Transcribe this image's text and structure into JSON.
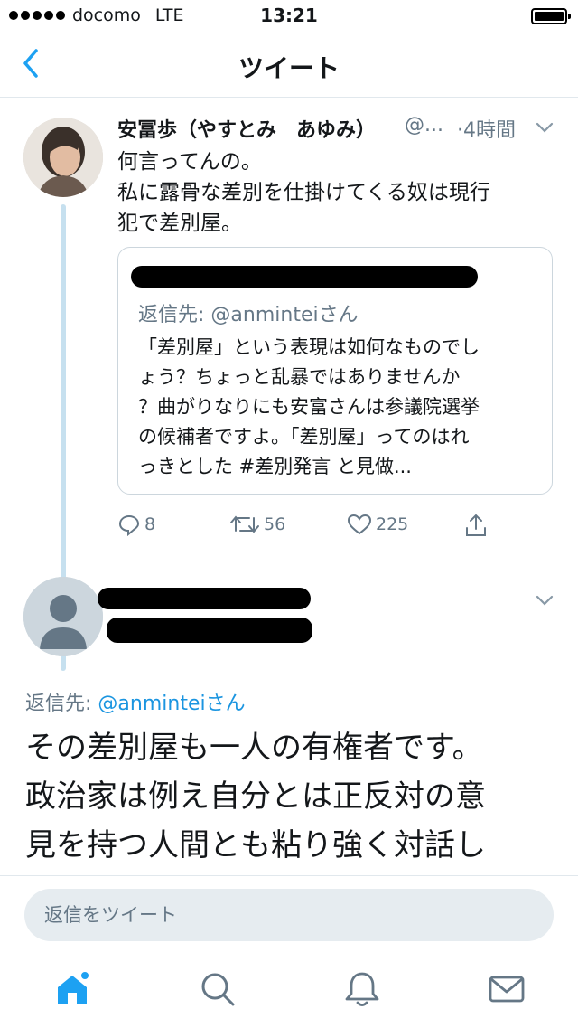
{
  "status_bar": {
    "carrier": "docomo",
    "network": "LTE",
    "time": "13:21"
  },
  "nav": {
    "title": "ツイート"
  },
  "tweet": {
    "author_name": "安冨歩（やすとみ　あゆみ）",
    "handle": "@...",
    "time": "·4時間",
    "text_lines": [
      "何言ってんの。",
      "私に露骨な差別を仕掛けてくる奴は現行",
      "犯で差別屋。"
    ],
    "quoted": {
      "reply_label": "返信先:",
      "reply_handle": "@anmintei",
      "reply_suffix": "さん",
      "text_lines": [
        "「差別屋」という表現は如何なものでし",
        "ょう？ちょっと乱暴ではありませんか",
        "？曲がりなりにも安富さんは参議院選挙",
        "の候補者ですよ。「差別屋」ってのはれ",
        "っきとした #差別発言 と見做..."
      ]
    },
    "actions": {
      "replies": "8",
      "retweets": "56",
      "likes": "225"
    }
  },
  "reply": {
    "reply_label": "返信先:",
    "reply_handle": "@anmintei",
    "reply_suffix": "さん",
    "text_lines": [
      "その差別屋も一人の有権者です。",
      "政治家は例え自分とは正反対の意",
      "見を持つ人間とも粘り強く対話し"
    ]
  },
  "compose": {
    "placeholder": "返信をツイート"
  },
  "colors": {
    "accent": "#1da1f2",
    "secondary_text": "#657786",
    "thread_line": "#c6e0ef"
  }
}
